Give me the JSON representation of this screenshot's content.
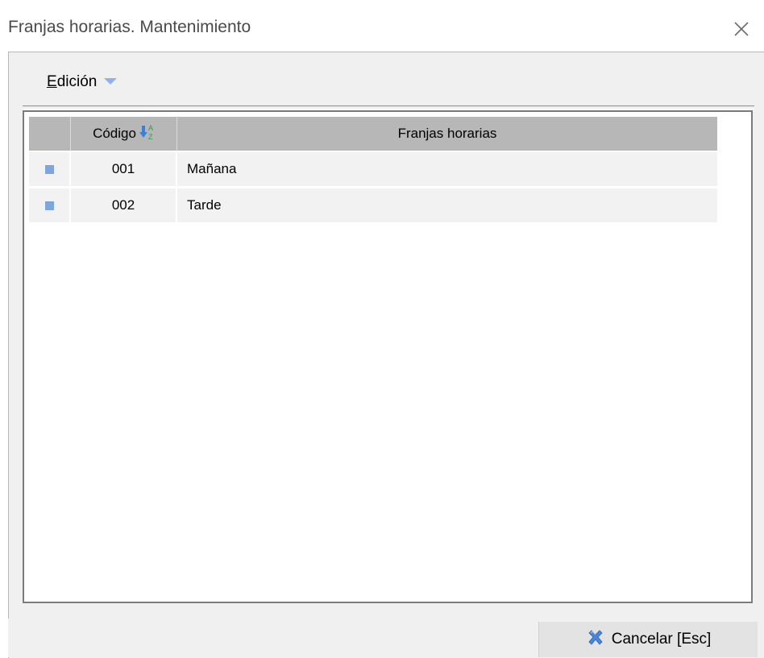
{
  "window": {
    "title": "Franjas horarias. Mantenimiento"
  },
  "menu": {
    "edit_label_accel": "E",
    "edit_label_rest": "dición"
  },
  "grid": {
    "columns": {
      "code": "Código",
      "description": "Franjas horarias"
    },
    "sort_icon": "sort-az-icon",
    "rows": [
      {
        "code": "001",
        "description": "Mañana"
      },
      {
        "code": "002",
        "description": "Tarde"
      }
    ],
    "marker_color": "#7fa6dc",
    "header_color": "#b7b7b7"
  },
  "footer": {
    "cancel_label": "Cancelar  [Esc]",
    "cancel_icon": "cancel-x-icon"
  }
}
